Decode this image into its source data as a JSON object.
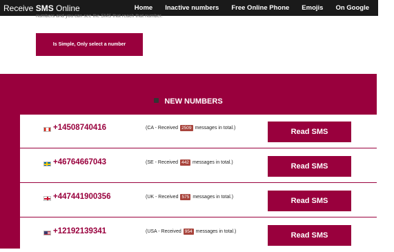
{
  "header": {
    "brand_plain": "Receive ",
    "brand_bold": "SMS",
    "brand_rest": " Online",
    "nav": [
      "Home",
      "Inactive numbers",
      "Free Online Phone",
      "Emojis",
      "On Google"
    ]
  },
  "intro": {
    "text": "numbers and you can see the SMS that reach that number.",
    "button_label": "Is Simple, Only select a number"
  },
  "panel": {
    "heading": "NEW NUMBERS",
    "heading_icon": "phone-icon",
    "colors": {
      "accent": "#99003d",
      "badge": "#a8443c"
    },
    "rows": [
      {
        "flag": "ca",
        "number": "+14508740416",
        "prefix": "(CA - Received",
        "count": "2509",
        "suffix": "messages in total.)",
        "button": "Read SMS"
      },
      {
        "flag": "se",
        "number": "+46764667043",
        "prefix": "(SE - Received",
        "count": "442",
        "suffix": "messages in total.)",
        "button": "Read SMS"
      },
      {
        "flag": "uk",
        "number": "+447441900356",
        "prefix": "(UK - Received",
        "count": "575",
        "suffix": "messages in total.)",
        "button": "Read SMS"
      },
      {
        "flag": "us",
        "number": "+12192139341",
        "prefix": "(USA - Received",
        "count": "954",
        "suffix": "messages in total.)",
        "button": "Read SMS"
      }
    ]
  }
}
